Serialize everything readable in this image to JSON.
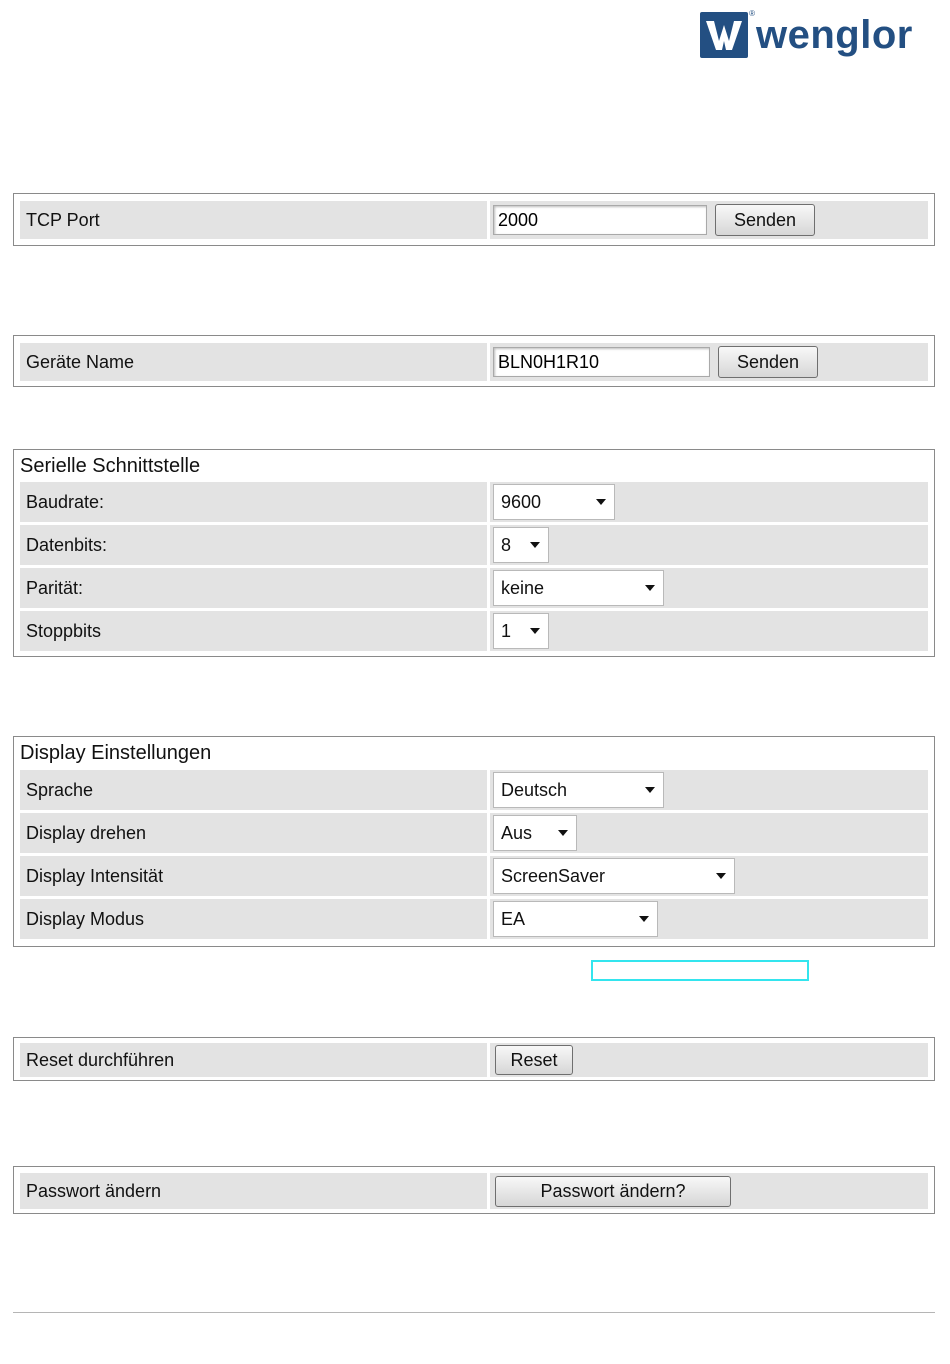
{
  "brand": {
    "name": "wenglor",
    "reg": "®",
    "logo_icon": "wenglor-w-logo-icon",
    "color": "#234f82"
  },
  "tcp": {
    "label": "TCP Port",
    "value": "2000",
    "button": "Senden"
  },
  "device": {
    "label": "Geräte Name",
    "value": "BLN0H1R10",
    "button": "Senden"
  },
  "serial": {
    "title": "Serielle Schnittstelle",
    "baud": {
      "label": "Baudrate:",
      "value": "9600"
    },
    "databits": {
      "label": "Datenbits:",
      "value": "8"
    },
    "parity": {
      "label": "Parität:",
      "value": "keine"
    },
    "stopbits": {
      "label": "Stoppbits",
      "value": "1"
    }
  },
  "display": {
    "title": "Display Einstellungen",
    "language": {
      "label": "Sprache",
      "value": "Deutsch"
    },
    "rotate": {
      "label": "Display drehen",
      "value": "Aus"
    },
    "intensity": {
      "label": "Display Intensität",
      "value": "ScreenSaver"
    },
    "mode": {
      "label": "Display Modus",
      "value": "EA"
    }
  },
  "reset": {
    "label": "Reset durchführen",
    "button": "Reset"
  },
  "password": {
    "label": "Passwort ändern",
    "button": "Passwort ändern?"
  },
  "colors": {
    "row_bg": "#e3e3e3",
    "border": "#8a8a8a",
    "highlight": "#33e5ee"
  }
}
